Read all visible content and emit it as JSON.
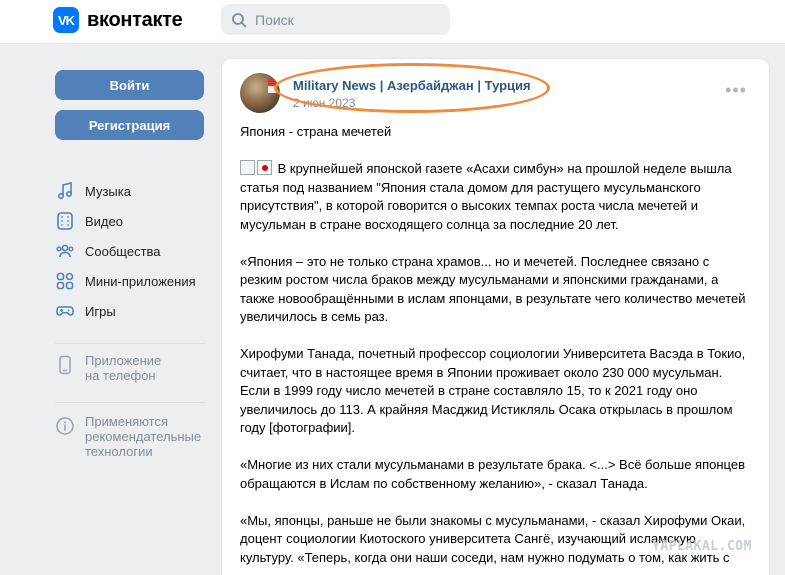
{
  "header": {
    "logo_mark": "VK",
    "logo_text": "вконтакте",
    "search_placeholder": "Поиск"
  },
  "sidebar": {
    "login_label": "Войти",
    "register_label": "Регистрация",
    "items": [
      {
        "label": "Музыка",
        "icon": "music-icon"
      },
      {
        "label": "Видео",
        "icon": "video-icon"
      },
      {
        "label": "Сообщества",
        "icon": "communities-icon"
      },
      {
        "label": "Мини-приложения",
        "icon": "mini-apps-icon"
      },
      {
        "label": "Игры",
        "icon": "games-icon"
      }
    ],
    "app_line1": "Приложение",
    "app_line2": "на телефон",
    "cookie_line1": "Применяются",
    "cookie_line2": "рекомендательные",
    "cookie_line3": "технологии"
  },
  "post": {
    "author": "Military News | Азербайджан | Турция",
    "date": "2 июн 2023",
    "title": "Япония - страна мечетей",
    "paragraphs": [
      "В крупнейшей японской газете «Асахи симбун» на прошлой неделе вышла статья под названием \"Япония стала домом для растущего мусульманского присутствия\", в которой говорится о высоких темпах роста числа мечетей и мусульман в стране восходящего солнца за последние 20 лет.",
      "«Япония – это не только страна храмов... но и мечетей. Последнее связано с резким ростом числа браков между мусульманами и японскими гражданами, а также новообращёнными в ислам японцами, в результате чего количество мечетей увеличилось в семь раз.",
      "Хирофуми Танада, почетный профессор социологии Университета Васэда в Токио, считает, что в настоящее время в Японии проживает около 230 000 мусульман. Если в 1999 году число мечетей в стране составляло 15, то к 2021 году оно увеличилось до 113. А крайняя Масджид Истикляль Осака открылась в прошлом году [фотографии].",
      "«Многие из них стали мусульманами в результате брака. <...> Всё больше японцев обращаются в Ислам по собственному желанию», - сказал Танада.",
      "«Мы, японцы, раньше не были знакомы с мусульманами, - сказал Хирофуми Окаи, доцент социологии Киотоского университета Сангё, изучающий исламскую культуру. «Теперь, когда они наши соседи, нам нужно подумать о том, как жить с"
    ]
  },
  "watermark": "YAPLAKAL.COM",
  "colors": {
    "vk_blue": "#0077ff",
    "button": "#5181b8",
    "link": "#2a5885",
    "annotation": "#ee8a3a"
  }
}
